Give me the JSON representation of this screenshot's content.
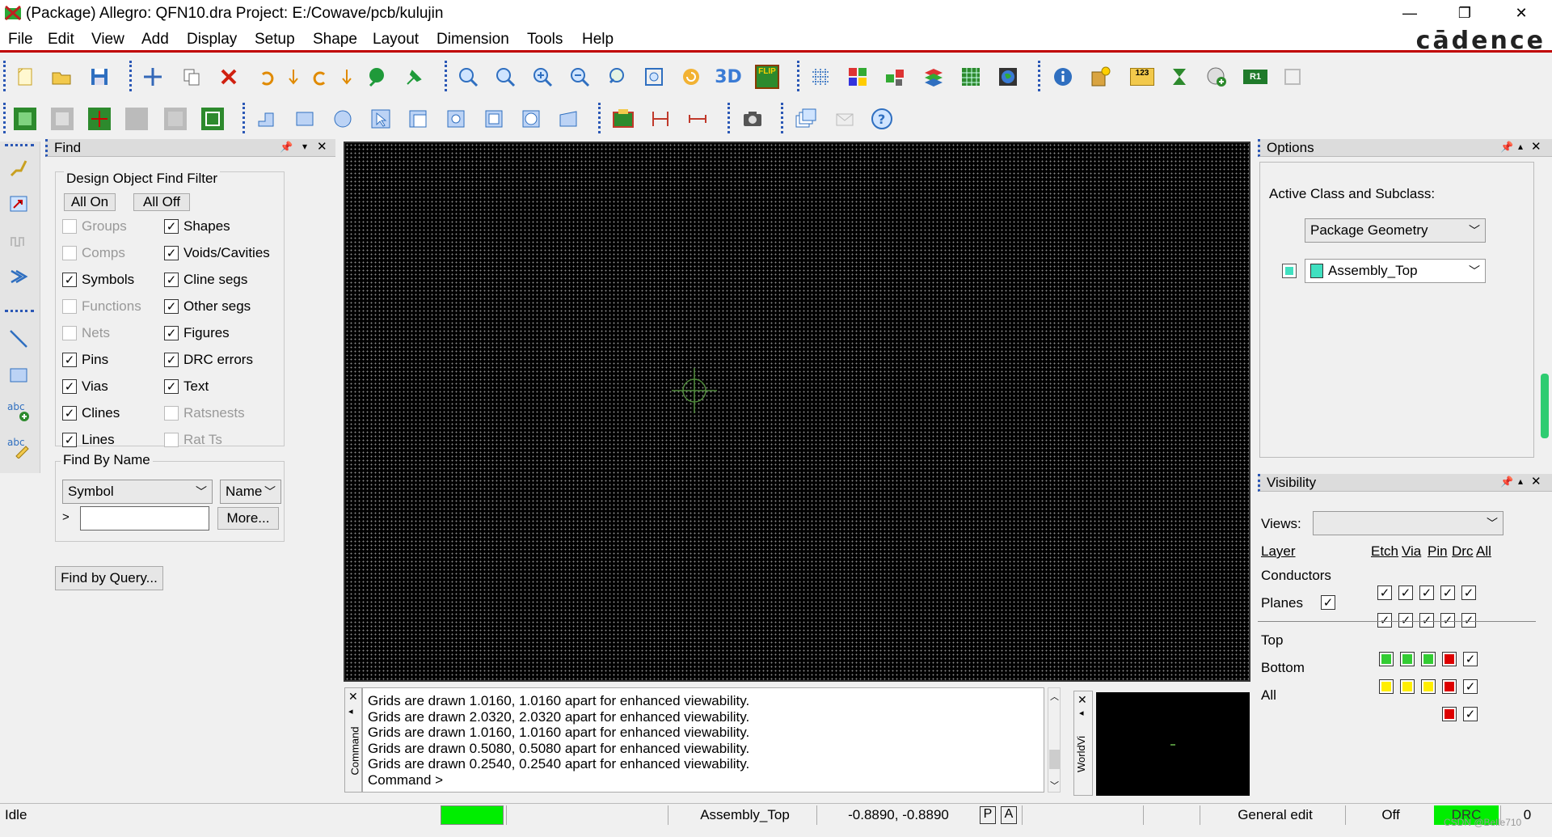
{
  "window": {
    "title": "(Package) Allegro: QFN10.dra  Project: E:/Cowave/pcb/kulujin",
    "minimize_glyph": "—",
    "restore_glyph": "❐",
    "close_glyph": "✕"
  },
  "menu": {
    "items": [
      "File",
      "Edit",
      "View",
      "Add",
      "Display",
      "Setup",
      "Shape",
      "Layout",
      "Dimension",
      "Tools",
      "Help"
    ],
    "logo": "cādence"
  },
  "toolbar1": {
    "icons": [
      "new-file-icon",
      "open-folder-icon",
      "save-icon",
      "move-icon",
      "copy-icon",
      "delete-icon",
      "undo-icon",
      "undo-down-icon",
      "redo-icon",
      "redo-down-icon",
      "add-connect-icon",
      "pin-icon",
      "zoom-points-icon",
      "zoom-fit-icon",
      "zoom-in-icon",
      "zoom-out-icon",
      "zoom-previous-icon",
      "zoom-world-icon",
      "redraw-icon",
      "view-3d-icon",
      "flip-icon",
      "grid-icon",
      "color-icon",
      "layer-icon",
      "stack-icon",
      "cm-icon",
      "globe-icon",
      "info-icon",
      "properties-icon",
      "measure-icon",
      "hourglass-icon",
      "add-via-icon",
      "r1-icon",
      "disabled-icon"
    ],
    "labels": {
      "three_d": "3D",
      "flip": "FLIP",
      "counter": "123",
      "r1": "R1"
    }
  },
  "toolbar2": {
    "icons": [
      "layout-icon",
      "layout-disabled-icon",
      "layout-green-icon",
      "layout-disabled2-icon",
      "layout-disabled3-icon",
      "layout-frame-icon",
      "corner-icon",
      "rectangle-icon",
      "circle-icon",
      "select-icon",
      "route-icon",
      "rotate-icon",
      "square-icon",
      "circle-square-icon",
      "fill-icon",
      "package-icon",
      "dimension-icon",
      "dimension-measure-icon",
      "camera-icon",
      "windows-icon",
      "mail-icon",
      "help-icon"
    ]
  },
  "find_panel": {
    "title": "Find",
    "group_title": "Design Object Find Filter",
    "all_on": "All On",
    "all_off": "All Off",
    "left_items": [
      {
        "label": "Groups",
        "checked": false,
        "enabled": false
      },
      {
        "label": "Comps",
        "checked": false,
        "enabled": false
      },
      {
        "label": "Symbols",
        "checked": true,
        "enabled": true
      },
      {
        "label": "Functions",
        "checked": false,
        "enabled": false
      },
      {
        "label": "Nets",
        "checked": false,
        "enabled": false
      },
      {
        "label": "Pins",
        "checked": true,
        "enabled": true
      },
      {
        "label": "Vias",
        "checked": true,
        "enabled": true
      },
      {
        "label": "Clines",
        "checked": true,
        "enabled": true
      },
      {
        "label": "Lines",
        "checked": true,
        "enabled": true
      }
    ],
    "right_items": [
      {
        "label": "Shapes",
        "checked": true,
        "enabled": true
      },
      {
        "label": "Voids/Cavities",
        "checked": true,
        "enabled": true
      },
      {
        "label": "Cline segs",
        "checked": true,
        "enabled": true
      },
      {
        "label": "Other segs",
        "checked": true,
        "enabled": true
      },
      {
        "label": "Figures",
        "checked": true,
        "enabled": true
      },
      {
        "label": "DRC errors",
        "checked": true,
        "enabled": true
      },
      {
        "label": "Text",
        "checked": true,
        "enabled": true
      },
      {
        "label": "Ratsnests",
        "checked": false,
        "enabled": false
      },
      {
        "label": "Rat Ts",
        "checked": false,
        "enabled": false
      }
    ],
    "find_by_name_title": "Find By Name",
    "type_select": "Symbol",
    "name_select": "Name",
    "name_input": "",
    "prompt_glyph": ">",
    "more_button": "More...",
    "find_by_query": "Find by Query..."
  },
  "options_panel": {
    "title": "Options",
    "label": "Active Class and Subclass:",
    "class_select": "Package Geometry",
    "subclass_select": "Assembly_Top",
    "subclass_color": "#40e0c0"
  },
  "visibility_panel": {
    "title": "Visibility",
    "views_label": "Views:",
    "views_value": "",
    "headers": {
      "layer": "Layer",
      "etch": "Etch",
      "via": "Via",
      "pin": "Pin",
      "drc": "Drc",
      "all": "All"
    },
    "conductors": "Conductors",
    "planes": "Planes",
    "layers": [
      {
        "name": "Top",
        "etch": "#33cc33",
        "via": "#33cc33",
        "pin": "#33cc33",
        "drc": "#dd0000"
      },
      {
        "name": "Bottom",
        "etch": "#ffee00",
        "via": "#ffee00",
        "pin": "#ffee00",
        "drc": "#dd0000"
      },
      {
        "name": "All",
        "drc": "#dd0000"
      }
    ]
  },
  "command_window": {
    "side_label": "Command",
    "lines": [
      "Grids are drawn 1.0160, 1.0160 apart for enhanced viewability.",
      "Grids are drawn 2.0320, 2.0320 apart for enhanced viewability.",
      "Grids are drawn 1.0160, 1.0160 apart for enhanced viewability.",
      "Grids are drawn 0.5080, 0.5080 apart for enhanced viewability.",
      "Grids are drawn 0.2540, 0.2540 apart for enhanced viewability."
    ],
    "prompt": "Command >"
  },
  "worldview": {
    "side_label": "WorldVi"
  },
  "statusbar": {
    "state": "Idle",
    "subclass": "Assembly_Top",
    "coords": "-0.8890, -0.8890",
    "p": "P",
    "a": "A",
    "mode": "General edit",
    "off": "Off",
    "drc": "DRC",
    "drc_count": "0",
    "watermark": "CSDN @Belle710",
    "active_color": "#00ee00"
  }
}
